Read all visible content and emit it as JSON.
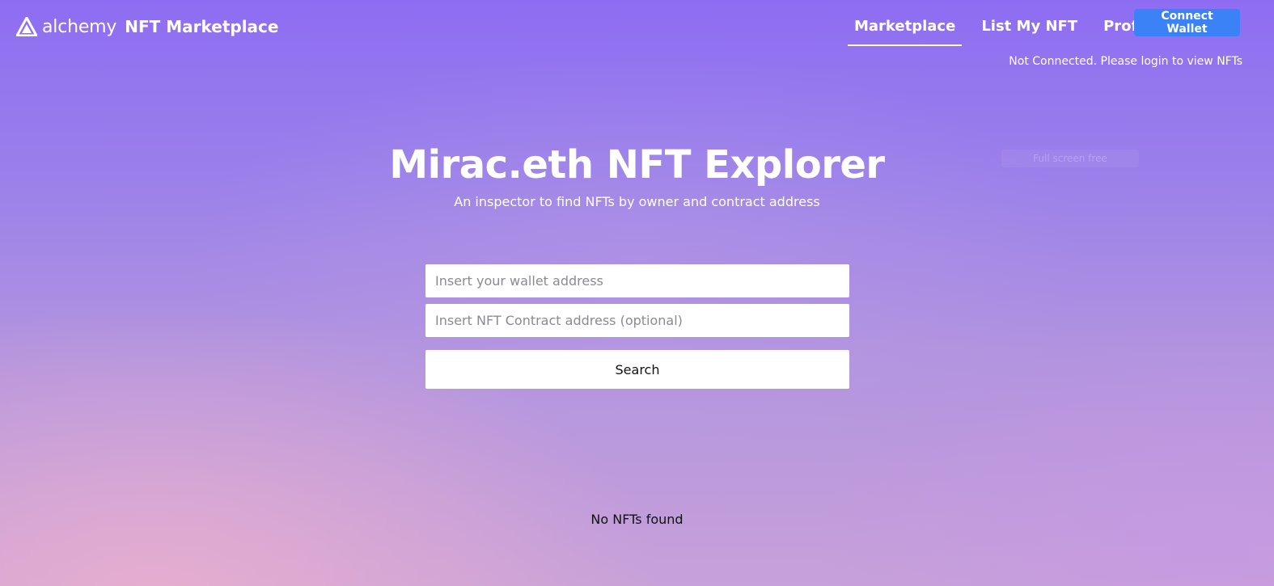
{
  "header": {
    "logo_text": "alchemy",
    "brand_title": "NFT Marketplace",
    "logo_icon": "alchemy-logo-icon",
    "nav": [
      {
        "label": "Marketplace",
        "active": true
      },
      {
        "label": "List My NFT",
        "active": false
      },
      {
        "label": "Profile",
        "active": false
      }
    ],
    "connect_label": "Connect Wallet",
    "status_text": "Not Connected. Please login to view NFTs"
  },
  "hero": {
    "title": "Mirac.eth NFT Explorer",
    "subtitle": "An inspector to find NFTs by owner and contract address"
  },
  "search": {
    "wallet_placeholder": "Insert your wallet address",
    "wallet_value": "",
    "contract_placeholder": "Insert NFT Contract address (optional)",
    "contract_value": "",
    "button_label": "Search"
  },
  "results": {
    "empty_text": "No NFTs found"
  },
  "ghost_overlay": "Full screen free",
  "colors": {
    "accent": "#3b82f6",
    "background_top": "#8e6df2",
    "background_bottom": "#c7a1d9"
  }
}
